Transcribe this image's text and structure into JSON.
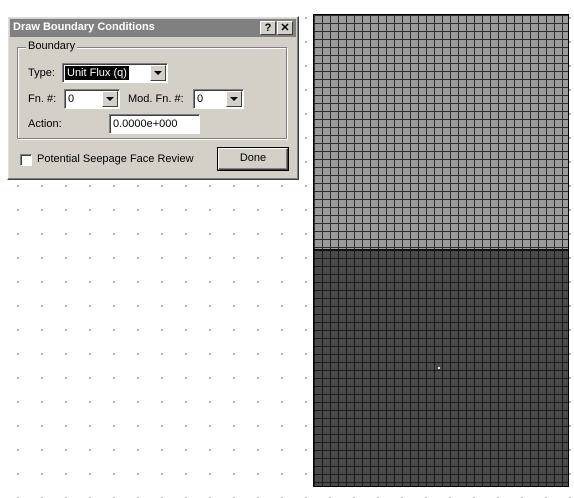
{
  "dialog": {
    "title": "Draw Boundary Conditions",
    "help_label": "?",
    "close_label": "✕",
    "group_label": "Boundary",
    "type_label": "Type:",
    "type_value": "Unit Flux (q)",
    "fn_label": "Fn. #:",
    "fn_value": "0",
    "mod_fn_label": "Mod. Fn. #:",
    "mod_fn_value": "0",
    "action_label": "Action:",
    "action_value": "0.0000e+000",
    "seepage_checkbox_label": "Potential Seepage Face Review",
    "seepage_checked": false,
    "done_label": "Done"
  },
  "colors": {
    "dialog_bg": "#d4d0c8",
    "titlebar": "#808080",
    "mesh_upper_region": "#9a9a9a",
    "mesh_lower_region": "#4a4a4a"
  },
  "icons": {
    "help": "help-icon",
    "close": "close-icon",
    "dropdown": "chevron-down-icon"
  }
}
